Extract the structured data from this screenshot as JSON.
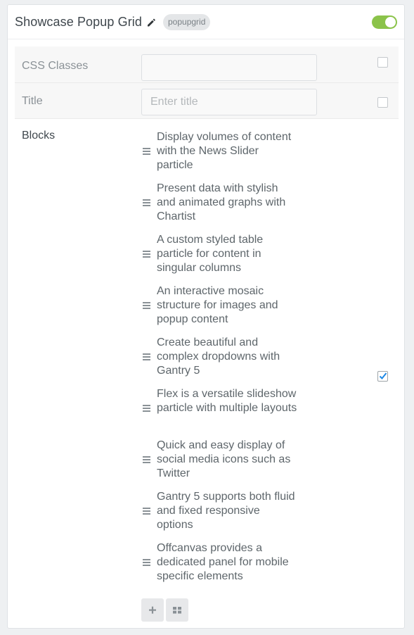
{
  "header": {
    "title": "Showcase Popup Grid",
    "badge": "popupgrid",
    "enabled": true,
    "accent_color": "#8bc34a"
  },
  "fields": {
    "css_classes": {
      "label": "CSS Classes",
      "value": "",
      "placeholder": ""
    },
    "title": {
      "label": "Title",
      "value": "",
      "placeholder": "Enter title"
    },
    "blocks": {
      "label": "Blocks"
    }
  },
  "blocks": [
    "Display volumes of content with the News Slider particle",
    "Present data with stylish and animated graphs with Chartist",
    "A custom styled table particle for content in singular columns",
    "An interactive mosaic structure for images and popup content",
    "Create beautiful and complex dropdowns with Gantry 5",
    "Flex is a versatile slideshow particle with multiple layouts",
    "Quick and easy display of social media icons such as Twitter",
    "Gantry 5 supports both fluid and fixed responsive options",
    "Offcanvas provides a dedicated panel for mobile specific elements"
  ],
  "icons": {
    "edit": "pencil-icon",
    "drag": "drag-handle-icon",
    "add": "plus-icon",
    "grid": "grid-icon",
    "check": "checkmark-icon"
  },
  "checkbox_color": "#1e88e5"
}
